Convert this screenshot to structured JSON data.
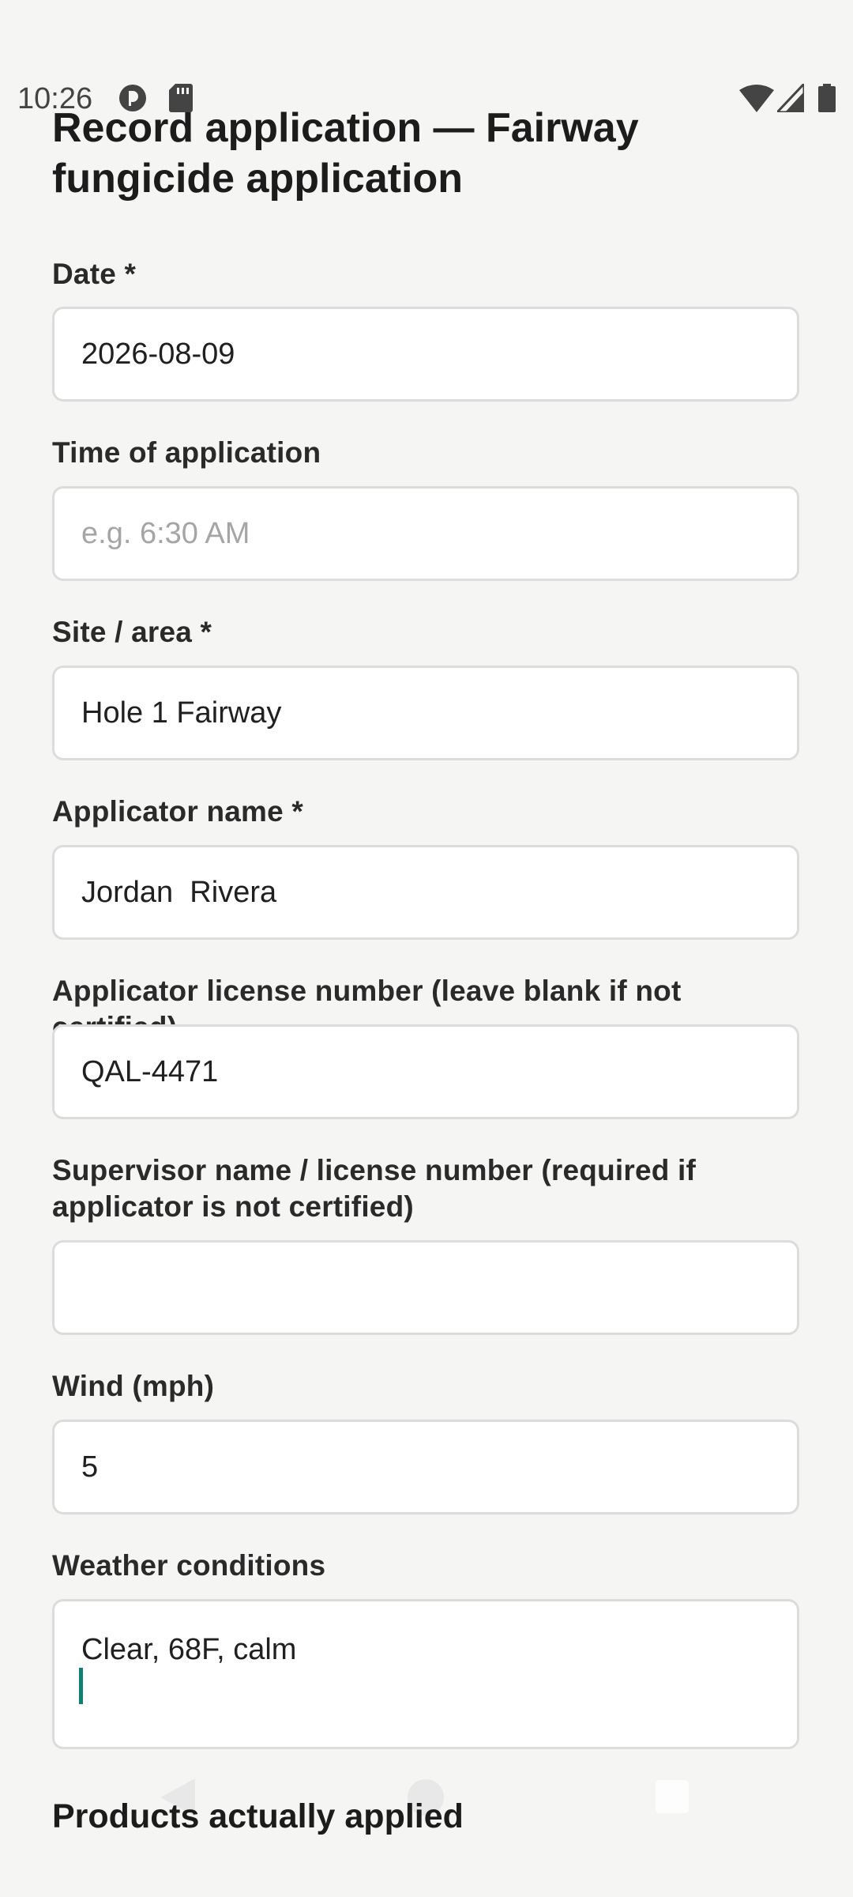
{
  "status_bar": {
    "time": "10:26",
    "left_icons": [
      "data-saver-icon",
      "sd-card-icon"
    ],
    "right_icons": [
      "wifi-icon",
      "cellular-signal-icon",
      "battery-icon"
    ]
  },
  "page": {
    "title_line1": "Record application — Fairway",
    "title_line2": "fungicide application"
  },
  "fields": {
    "date": {
      "label": "Date *",
      "value": "2026-08-09"
    },
    "time": {
      "label": "Time of application",
      "value": "",
      "placeholder": "e.g. 6:30 AM"
    },
    "site": {
      "label": "Site / area *",
      "value": "Hole 1 Fairway"
    },
    "applicator_name": {
      "label": "Applicator name *",
      "value": "Jordan  Rivera"
    },
    "license": {
      "label": "Applicator license number (leave blank if not certified)",
      "value": "QAL-4471"
    },
    "supervisor": {
      "label_line1": "Supervisor name / license number (required if",
      "label_line2": "applicator is not certified)",
      "value": ""
    },
    "wind": {
      "label": "Wind (mph)",
      "value": "5"
    },
    "weather": {
      "label": "Weather conditions",
      "value": "Clear, 68F, calm"
    }
  },
  "sections": {
    "products_heading": "Products actually applied"
  },
  "nav_bar": {
    "icons": [
      "back-icon",
      "home-icon",
      "recents-icon"
    ]
  },
  "colors": {
    "background": "#f5f5f4",
    "field_border": "#dcdcdc",
    "cursor": "#0f7f74"
  }
}
